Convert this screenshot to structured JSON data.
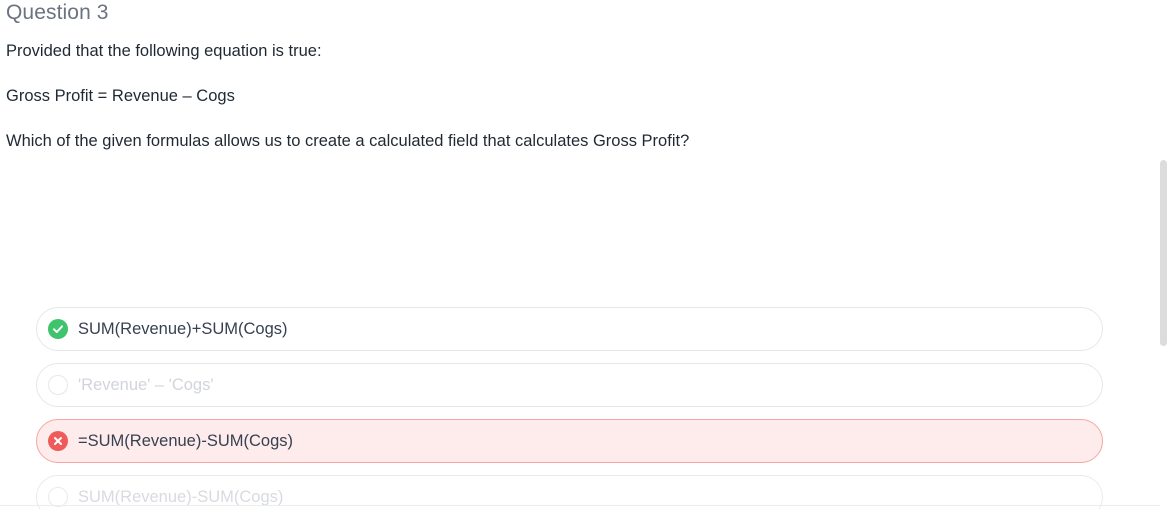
{
  "question": {
    "title": "Question 3",
    "intro": "Provided that the following equation is true:",
    "equation": "Gross Profit = Revenue – Cogs",
    "prompt": "Which of the given formulas allows us to create a calculated field that calculates Gross Profit?"
  },
  "options": [
    {
      "label": "SUM(Revenue)+SUM(Cogs)",
      "state": "correct",
      "icon": "check-circle-icon"
    },
    {
      "label": "'Revenue' – 'Cogs'",
      "state": "neutral",
      "icon": "radio-empty-icon"
    },
    {
      "label": "=SUM(Revenue)-SUM(Cogs)",
      "state": "wrong",
      "icon": "x-circle-icon"
    },
    {
      "label": "SUM(Revenue)-SUM(Cogs)",
      "state": "neutral",
      "icon": "radio-empty-icon"
    }
  ],
  "colors": {
    "correct": "#3ec46d",
    "wrong": "#ef5b5b",
    "wrong_bg": "#fdeceb"
  }
}
